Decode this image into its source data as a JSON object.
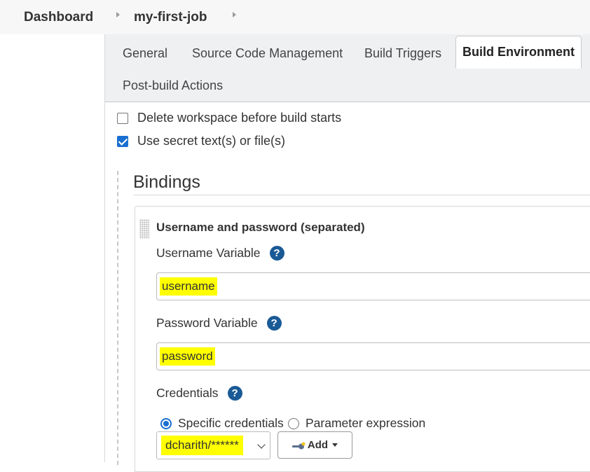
{
  "breadcrumb": {
    "items": [
      "Dashboard",
      "my-first-job"
    ]
  },
  "tabs": [
    {
      "label": "General"
    },
    {
      "label": "Source Code Management"
    },
    {
      "label": "Build Triggers"
    },
    {
      "label": "Build Environment",
      "active": true
    },
    {
      "label": "Post-build Actions"
    }
  ],
  "options": {
    "delete_workspace": {
      "label": "Delete workspace before build starts",
      "checked": false
    },
    "use_secret": {
      "label": "Use secret text(s) or file(s)",
      "checked": true
    }
  },
  "bindings": {
    "title": "Bindings",
    "binding_type": "Username and password (separated)",
    "username_label": "Username Variable",
    "username_value": "username",
    "password_label": "Password Variable",
    "password_value": "password",
    "credentials_label": "Credentials",
    "radio_specific": "Specific credentials",
    "radio_parameter": "Parameter expression",
    "selected_credential": "dcharith/******",
    "add_label": "Add",
    "help_glyph": "?"
  },
  "colors": {
    "accent": "#1a6fd1",
    "help": "#1a5a96",
    "highlight": "#ffff00"
  },
  "icons": [
    "chevron-right-icon",
    "help-icon",
    "key-icon",
    "caret-down-icon",
    "chevron-down-icon",
    "drag-handle-icon"
  ]
}
